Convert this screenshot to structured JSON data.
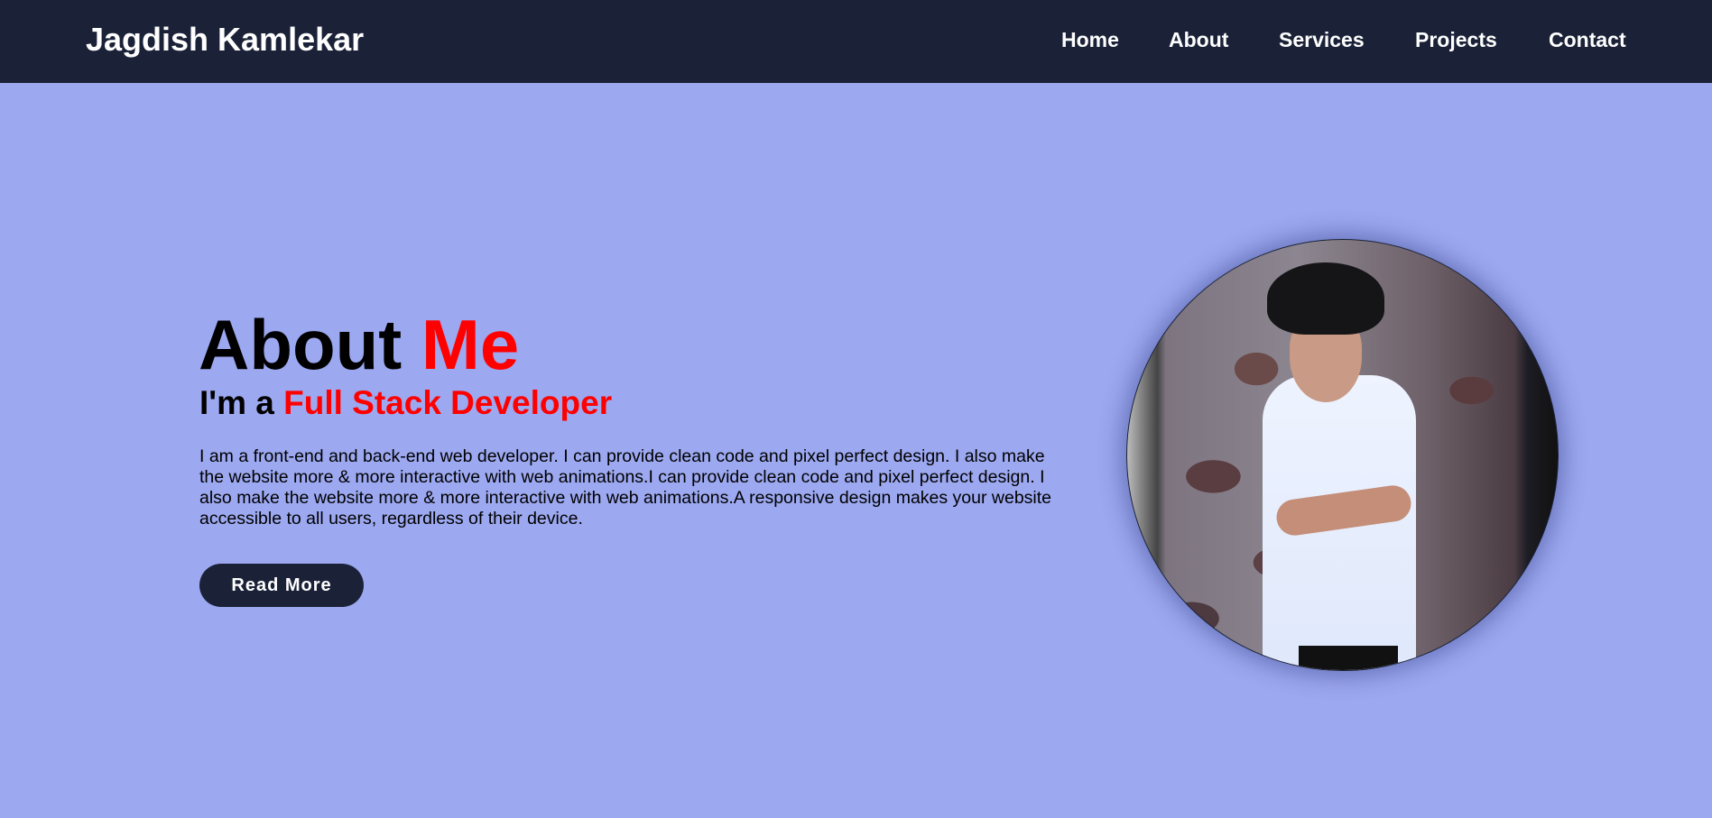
{
  "header": {
    "logo": "Jagdish Kamlekar",
    "nav": [
      {
        "label": "Home"
      },
      {
        "label": "About"
      },
      {
        "label": "Services"
      },
      {
        "label": "Projects"
      },
      {
        "label": "Contact"
      }
    ]
  },
  "about": {
    "title_part1": "About",
    "title_part2": "Me",
    "subtitle_part1": "I'm a",
    "subtitle_part2": "Full Stack Developer",
    "paragraph": "I am a front-end and back-end web developer. I can provide clean code and pixel perfect design. I also make the website more & more interactive with web animations.I can provide clean code and pixel perfect design. I also make the website more & more interactive with web animations.A responsive design makes your website accessible to all users, regardless of their device.",
    "button_label": "Read More",
    "image": "profile-photo"
  },
  "colors": {
    "header_bg": "#1b2238",
    "page_bg": "#9ca8f0",
    "accent": "#ff0000"
  }
}
